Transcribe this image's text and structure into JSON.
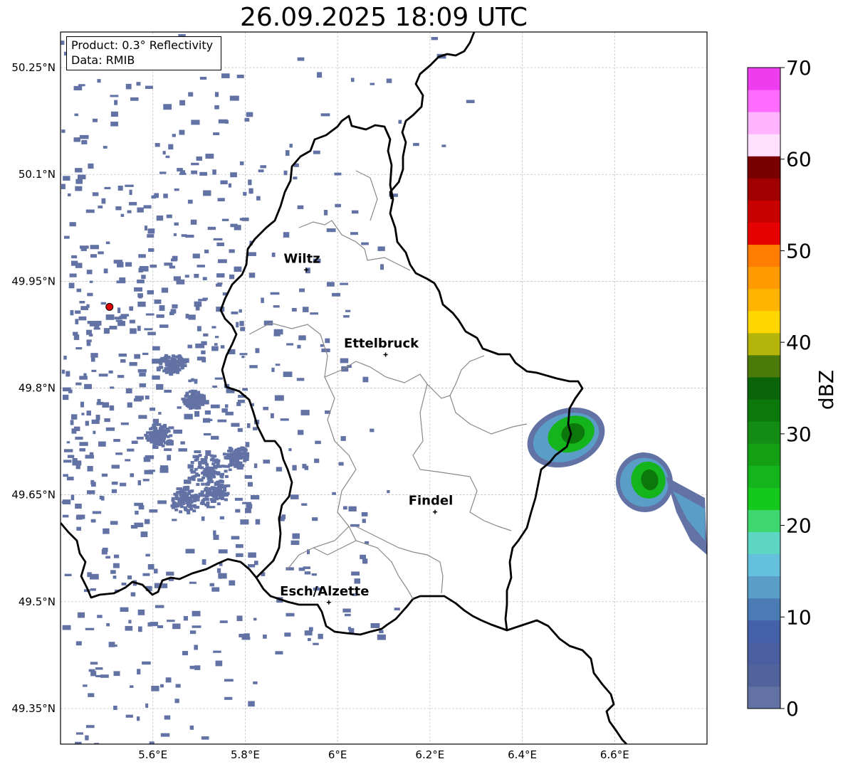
{
  "title": "26.09.2025 18:09 UTC",
  "info": {
    "product": "Product: 0.3° Reflectivity",
    "data_source": "Data: RMIB"
  },
  "map": {
    "lon_range": [
      5.4,
      6.8
    ],
    "lat_range": [
      49.3,
      50.3
    ],
    "x_ticks": [
      {
        "value": 5.6,
        "label": "5.6°E"
      },
      {
        "value": 5.8,
        "label": "5.8°E"
      },
      {
        "value": 6.0,
        "label": "6°E"
      },
      {
        "value": 6.2,
        "label": "6.2°E"
      },
      {
        "value": 6.4,
        "label": "6.4°E"
      },
      {
        "value": 6.6,
        "label": "6.6°E"
      }
    ],
    "y_ticks": [
      {
        "value": 50.25,
        "label": "50.25°N"
      },
      {
        "value": 50.1,
        "label": "50.1°N"
      },
      {
        "value": 49.95,
        "label": "49.95°N"
      },
      {
        "value": 49.8,
        "label": "49.8°N"
      },
      {
        "value": 49.65,
        "label": "49.65°N"
      },
      {
        "value": 49.5,
        "label": "49.5°N"
      },
      {
        "value": 49.35,
        "label": "49.35°N"
      }
    ],
    "grid": true,
    "radar_site": {
      "lon": 5.506,
      "lat": 49.914
    },
    "cities": [
      {
        "name": "Wiltz",
        "lon": 5.932,
        "lat": 49.966
      },
      {
        "name": "Ettelbruck",
        "lon": 6.104,
        "lat": 49.847
      },
      {
        "name": "Findel",
        "lon": 6.211,
        "lat": 49.626
      },
      {
        "name": "Esch/Alzette",
        "lon": 5.981,
        "lat": 49.499
      }
    ]
  },
  "colorbar": {
    "label": "dBZ",
    "min": 0,
    "max": 70,
    "tick_labels": [
      "0",
      "10",
      "20",
      "30",
      "40",
      "50",
      "60",
      "70"
    ],
    "colors": [
      "#6272a4",
      "#52639b",
      "#4a5ea0",
      "#4460a8",
      "#4a7bb5",
      "#5a9ec8",
      "#64c0dc",
      "#5ed6c4",
      "#3ed66e",
      "#14c81c",
      "#14b41c",
      "#14a014",
      "#148c14",
      "#0c780c",
      "#0a640a",
      "#4a7a0a",
      "#b4b40a",
      "#ffd700",
      "#ffb400",
      "#ff9b00",
      "#ff7d00",
      "#e60000",
      "#c80000",
      "#a00000",
      "#780000",
      "#ffe0ff",
      "#ffb4ff",
      "#ff6cff",
      "#ee3cee"
    ]
  },
  "echo_colors": {
    "weak": "#6272a4",
    "cell_a": "#14b41c",
    "cell_b": "#0c780c",
    "edge": "#5a9ec8"
  }
}
